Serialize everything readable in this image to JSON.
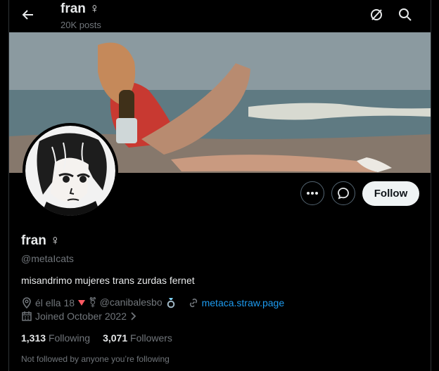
{
  "header": {
    "title": "fran ♀︎",
    "posts": "20K posts"
  },
  "profile": {
    "name": "fran ♀︎",
    "handle": "@metaIcats",
    "bio": "misandrimo mujeres trans zurdas fernet",
    "location": "él ella 18",
    "location_extra": "⚧ @canibalesbo",
    "website": "metaca.straw.page",
    "joined": "Joined October 2022",
    "following_count": "1,313",
    "following_label": "Following",
    "followers_count": "3,071",
    "followers_label": "Followers",
    "followed_by": "Not followed by anyone you’re following"
  },
  "actions": {
    "follow": "Follow"
  },
  "colors": {
    "accent": "#1d9bf0",
    "muted": "#71767b",
    "follow_bg": "#eff3f4"
  }
}
